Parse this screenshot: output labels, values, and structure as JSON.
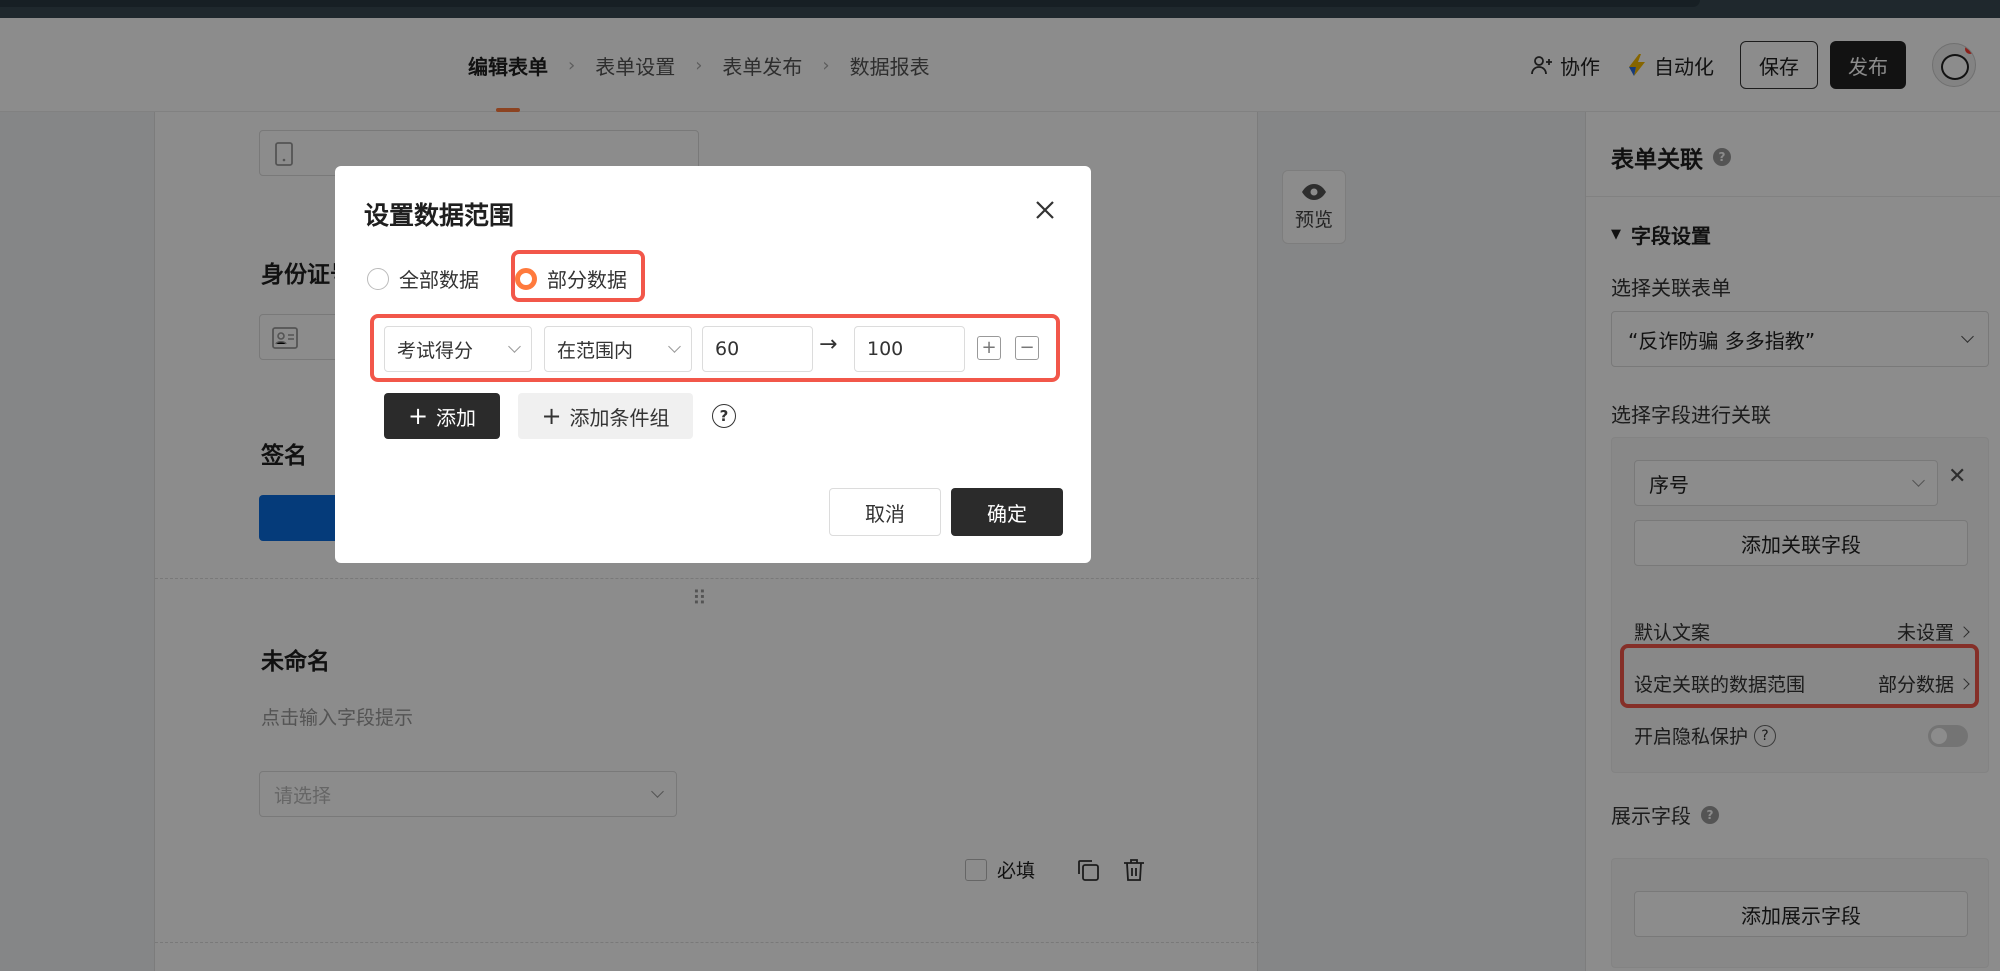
{
  "header": {
    "steps": [
      "编辑表单",
      "表单设置",
      "表单发布",
      "数据报表"
    ],
    "active_step": "编辑表单",
    "collab_label": "协作",
    "automation_label": "自动化",
    "save_label": "保存",
    "publish_label": "发布"
  },
  "form": {
    "id_card_title": "身份证号",
    "signature_title": "签名",
    "unnamed_title": "未命名",
    "unnamed_hint": "点击输入字段提示",
    "select_placeholder": "请选择",
    "required_label": "必填",
    "preview_label": "预览"
  },
  "right_panel": {
    "title": "表单关联",
    "section_title": "字段设置",
    "select_form_label": "选择关联表单",
    "selected_form": "“反诈防骗 多多指教”",
    "select_field_label": "选择字段进行关联",
    "field_value": "序号",
    "add_link_field": "添加关联字段",
    "default_copy_label": "默认文案",
    "default_copy_value": "未设置",
    "data_range_label": "设定关联的数据范围",
    "data_range_value": "部分数据",
    "privacy_label": "开启隐私保护",
    "display_fields_label": "展示字段",
    "add_display_field": "添加展示字段"
  },
  "modal": {
    "title": "设置数据范围",
    "radio_all": "全部数据",
    "radio_partial": "部分数据",
    "selected_radio": "部分数据",
    "condition": {
      "field": "考试得分",
      "operator": "在范围内",
      "min": "60",
      "max": "100"
    },
    "add_label": "添加",
    "add_group_label": "添加条件组",
    "cancel_label": "取消",
    "ok_label": "确定"
  },
  "colors": {
    "accent": "#ff7a3d",
    "highlight": "#f2574a",
    "primary_dark": "#2b2b2b",
    "signature_blue": "#0a6cde"
  }
}
